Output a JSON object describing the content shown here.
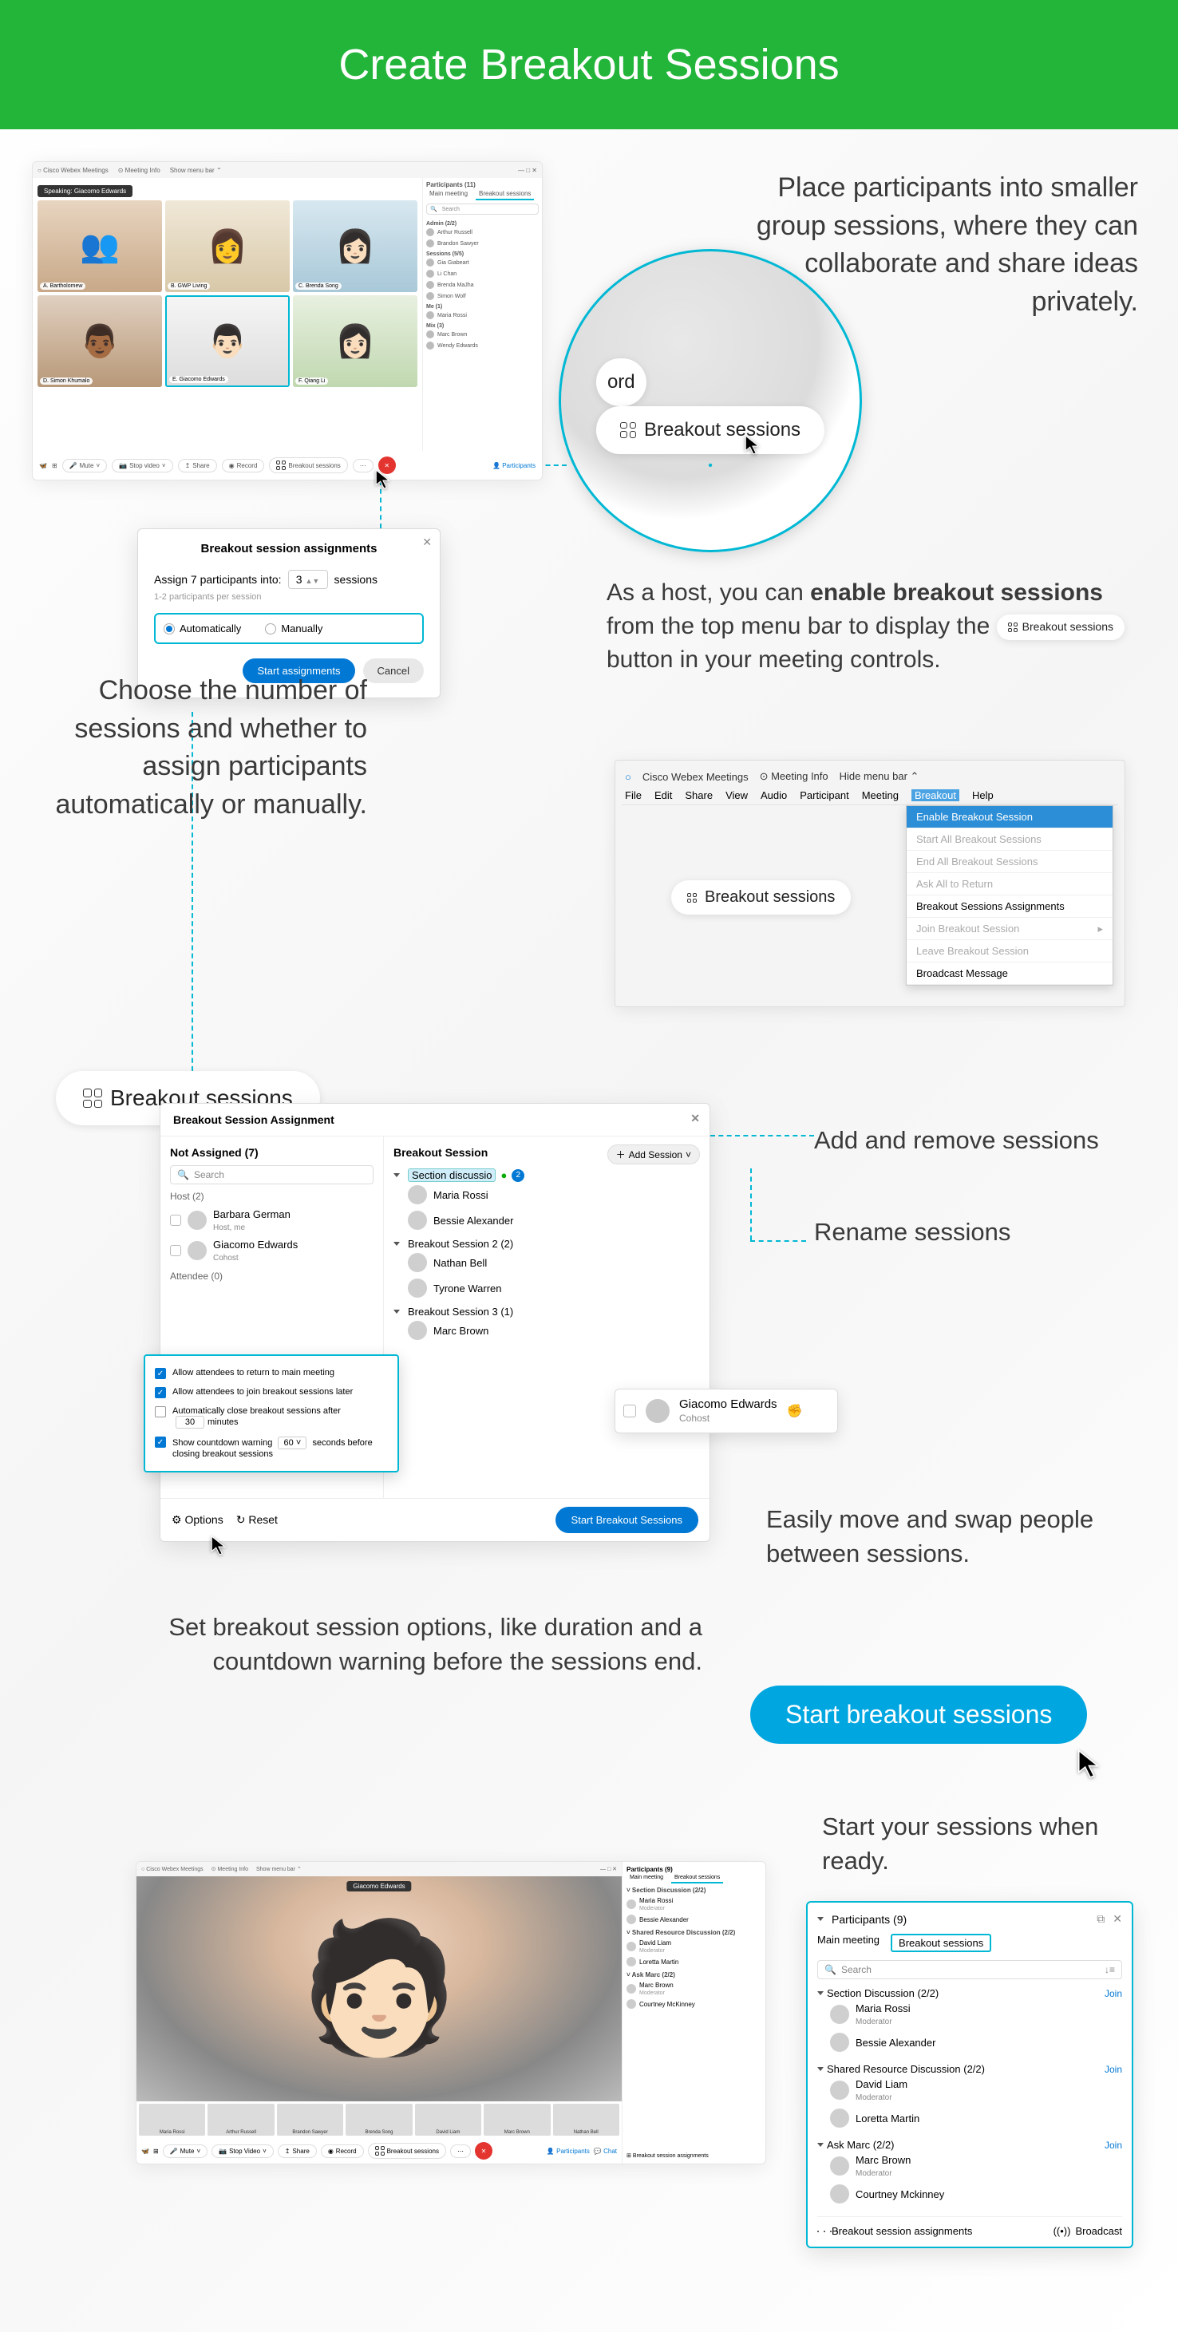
{
  "banner": "Create Breakout Sessions",
  "intro": "Place participants into smaller group sessions, where they can collaborate and share ideas privately.",
  "zoom": {
    "ord": "ord",
    "breakout": "Breakout sessions"
  },
  "caption_choose": "Choose the number of sessions and whether to assign participants automatically or manually.",
  "enable": {
    "pre": "As a host, you can ",
    "bold": "enable breakout sessions",
    "mid": " from the top menu bar to display the ",
    "pill": "Breakout sessions",
    "post": " button in your meeting controls."
  },
  "captions": {
    "addremove": "Add and remove sessions",
    "rename": "Rename sessions",
    "moveswap": "Easily move and swap people between sessions.",
    "options": "Set breakout session options, like duration and a countdown warning before the sessions end.",
    "start": "Start your sessions when ready."
  },
  "scr1": {
    "app": "Cisco Webex Meetings",
    "meeting_info": "⊙ Meeting Info",
    "hide_menu": "Show menu bar ⌃",
    "speaking_prefix": "Speaking: ",
    "speaking": "Giacomo Edwards",
    "tiles": [
      "A. Bartholomew",
      "B. GWP Living",
      "C. Brenda Song",
      "D. Simon Khumalo",
      "E. Giacomo Edwards",
      "F. Qiang Li"
    ],
    "bar": {
      "mute": "Mute",
      "stop": "Stop video",
      "share": "Share",
      "record": "Record",
      "breakout": "Breakout sessions",
      "participants": "Participants"
    },
    "side": {
      "title": "Participants (11)",
      "tab1": "Main meeting",
      "tab2": "Breakout sessions",
      "search": "Search",
      "admin_h": "Admin (2/2)",
      "admin": [
        "Arthur Russell",
        "Brandon Sawyer"
      ],
      "sess_h": "Sessions (5/5)",
      "sess": [
        "Gia Giabeart",
        "Li Chan",
        "Brenda MaJha",
        "Simon Wolf"
      ],
      "me_h": "Me (1)",
      "me": [
        "Maria Rossi"
      ],
      "att_h": "Mix (3)",
      "att": [
        "Marc Brown",
        "Wendy Edwards"
      ]
    }
  },
  "dlg1": {
    "title": "Breakout session assignments",
    "assign_pre": "Assign 7 participants into:",
    "count": "3",
    "assign_post": "sessions",
    "hint": "1-2 participants per session",
    "auto": "Automatically",
    "manual": "Manually",
    "start": "Start assignments",
    "cancel": "Cancel"
  },
  "scrmenu": {
    "app": "Cisco Webex Meetings",
    "info": "⊙ Meeting Info",
    "hide": "Hide menu bar ⌃",
    "menu": [
      "File",
      "Edit",
      "Share",
      "View",
      "Audio",
      "Participant",
      "Meeting",
      "Breakout",
      "Help"
    ],
    "dd": [
      "Enable Breakout Session",
      "Start All Breakout Sessions",
      "End All Breakout Sessions",
      "Ask All to Return",
      "Breakout Sessions Assignments",
      "Join Breakout Session",
      "Leave Breakout Session",
      "Broadcast Message"
    ],
    "pill": "Breakout sessions"
  },
  "big_pill": "Breakout sessions",
  "apanel": {
    "title": "Breakout Session Assignment",
    "left": {
      "h": "Not Assigned (7)",
      "search": "Search",
      "host_h": "Host (2)",
      "hosts": [
        {
          "n": "Barbara German",
          "s": "Host, me"
        },
        {
          "n": "Giacomo Edwards",
          "s": "Cohost"
        }
      ],
      "att_h": "Attendee (0)"
    },
    "right": {
      "h": "Breakout Session",
      "add": "Add Session",
      "s1": {
        "name": "Section discussio",
        "count": "2",
        "p": [
          "Maria Rossi",
          "Bessie Alexander"
        ]
      },
      "s2": {
        "name": "Breakout Session 2 (2)",
        "p": [
          "Nathan Bell",
          "Tyrone Warren"
        ]
      },
      "s3": {
        "name": "Breakout Session 3 (1)",
        "p": [
          "Marc Brown"
        ]
      }
    },
    "foot": {
      "options": "Options",
      "reset": "Reset",
      "start": "Start Breakout Sessions"
    }
  },
  "opts": {
    "o1": "Allow attendees to return to main meeting",
    "o2": "Allow attendees to join breakout sessions later",
    "o3_pre": "Automatically close breakout sessions after",
    "o3_val": "30",
    "o3_post": "minutes",
    "o4_pre": "Show countdown warning",
    "o4_val": "60",
    "o4_post": "seconds before closing breakout sessions"
  },
  "card": {
    "name": "Giacomo Edwards",
    "role": "Cohost"
  },
  "big_start": "Start breakout sessions",
  "scr2": {
    "app": "Cisco Webex Meetings",
    "meeting_info": "⊙ Meeting Info",
    "hide": "Show menu bar ⌃",
    "speaker": "Giacomo Edwards",
    "thumbs": [
      "Maria Rossi",
      "Arthur Russell",
      "Brandon Sawyer",
      "Brenda Song",
      "David Liam",
      "Marc Brown",
      "Nathan Bell"
    ],
    "bar": {
      "mute": "Mute",
      "stop": "Stop Video",
      "share": "Share",
      "record": "Record",
      "breakout": "Breakout sessions",
      "participants": "Participants",
      "chat": "Chat"
    },
    "side": {
      "title": "Participants (9)",
      "tab1": "Main meeting",
      "tab2": "Breakout sessions",
      "g1": {
        "h": "Section Discussion (2/2)",
        "p": [
          {
            "n": "Maria Rossi",
            "s": "Moderator"
          },
          {
            "n": "Bessie Alexander",
            "s": ""
          }
        ]
      },
      "g2": {
        "h": "Shared Resource Discussion (2/2)",
        "p": [
          {
            "n": "David Liam",
            "s": "Moderator"
          },
          {
            "n": "Loretta Martin",
            "s": ""
          }
        ]
      },
      "g3": {
        "h": "Ask Marc (2/2)",
        "p": [
          {
            "n": "Marc Brown",
            "s": "Moderator"
          },
          {
            "n": "Courtney McKinney",
            "s": ""
          }
        ]
      },
      "assign": "Breakout session assignments"
    }
  },
  "ppop": {
    "title": "Participants (9)",
    "tab1": "Main meeting",
    "tab2": "Breakout sessions",
    "search": "Search",
    "g1": {
      "h": "Section Discussion (2/2)",
      "join": "Join",
      "p": [
        {
          "n": "Maria Rossi",
          "s": "Moderator"
        },
        {
          "n": "Bessie Alexander",
          "s": ""
        }
      ]
    },
    "g2": {
      "h": "Shared Resource Discussion (2/2)",
      "join": "Join",
      "p": [
        {
          "n": "David Liam",
          "s": "Moderator"
        },
        {
          "n": "Loretta Martin",
          "s": ""
        }
      ]
    },
    "g3": {
      "h": "Ask Marc (2/2)",
      "join": "Join",
      "p": [
        {
          "n": "Marc Brown",
          "s": "Moderator"
        },
        {
          "n": "Courtney Mckinney",
          "s": ""
        }
      ]
    },
    "bot1": "Breakout session assignments",
    "bot2": "Broadcast"
  }
}
